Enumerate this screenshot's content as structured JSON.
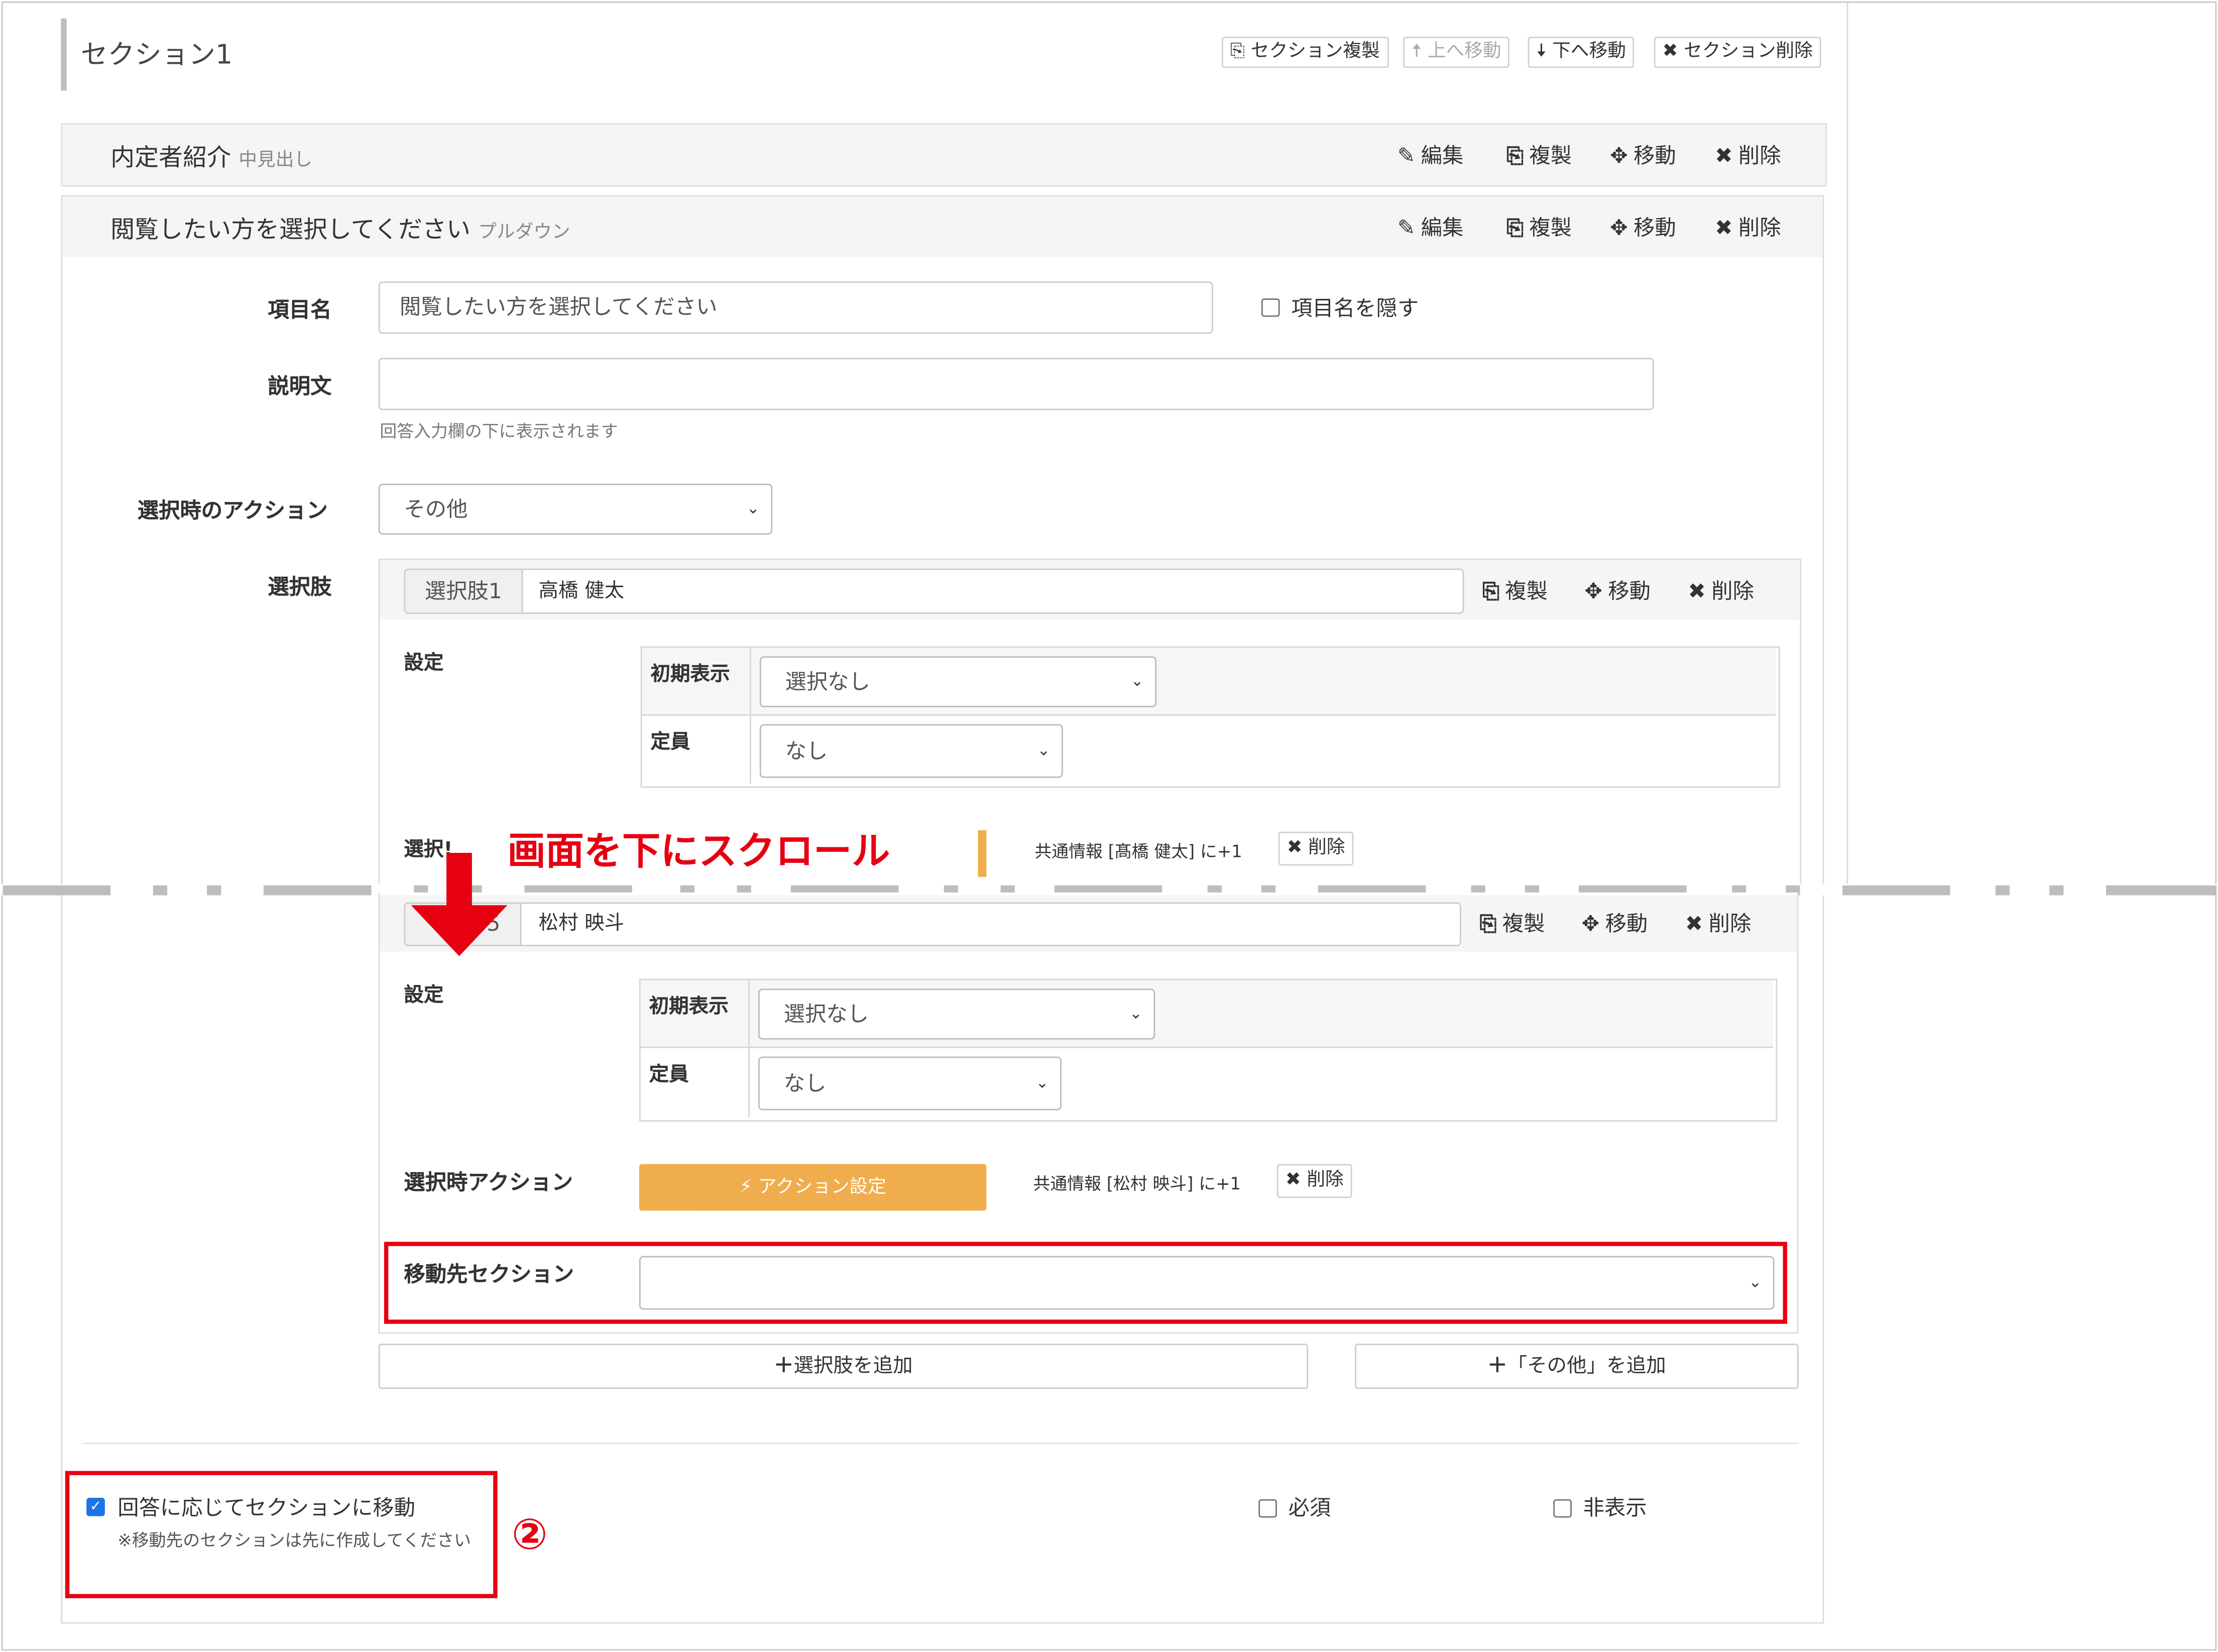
{
  "section": {
    "title": "セクション1",
    "toolbar": {
      "duplicate": "セクション複製",
      "move_up": "上へ移動",
      "move_down": "下へ移動",
      "delete": "セクション削除"
    }
  },
  "items": [
    {
      "title": "内定者紹介",
      "type": "中見出し"
    },
    {
      "title": "閲覧したい方を選択してください",
      "type": "プルダウン"
    }
  ],
  "item_actions": {
    "edit": "編集",
    "copy": "複製",
    "move": "移動",
    "delete": "削除"
  },
  "form": {
    "item_name_label": "項目名",
    "item_name_value": "閲覧したい方を選択してください",
    "hide_name_label": "項目名を隠す",
    "description_label": "説明文",
    "description_value": "",
    "description_help": "回答入力欄の下に表示されます",
    "select_action_label": "選択時のアクション",
    "select_action_value": "その他",
    "choices_label": "選択肢"
  },
  "choices": [
    {
      "prefix": "選択肢1",
      "value": "高橋 健太",
      "settings_label": "設定",
      "initial_label": "初期表示",
      "initial_value": "選択なし",
      "capacity_label": "定員",
      "capacity_value": "なし",
      "action_label_partial": "選択!",
      "common_info": "共通情報 [髙橋 健太] に+1",
      "delete": "削除"
    },
    {
      "prefix": "選択肢5",
      "prefix_visible": "5",
      "value": "松村 映斗",
      "settings_label": "設定",
      "initial_label": "初期表示",
      "initial_value": "選択なし",
      "capacity_label": "定員",
      "capacity_value": "なし",
      "action_label": "選択時アクション",
      "action_button": "アクション設定",
      "common_info": "共通情報 [松村 映斗] に+1",
      "delete": "削除",
      "jump_label": "移動先セクション",
      "jump_value": ""
    }
  ],
  "choice_actions": {
    "copy": "複製",
    "move": "移動",
    "delete": "削除"
  },
  "add_choice": "選択肢を追加",
  "add_other": "「その他」を追加",
  "footer": {
    "branch_label": "回答に応じてセクションに移動",
    "branch_note": "※移動先のセクションは先に作成してください",
    "required_label": "必須",
    "hidden_label": "非表示"
  },
  "annotation": {
    "scroll_text": "画面を下にスクロール",
    "number": "②"
  },
  "colors": {
    "highlight": "#e60012",
    "accent_orange": "#f0ad4e",
    "checkbox_blue": "#1a73e8"
  }
}
